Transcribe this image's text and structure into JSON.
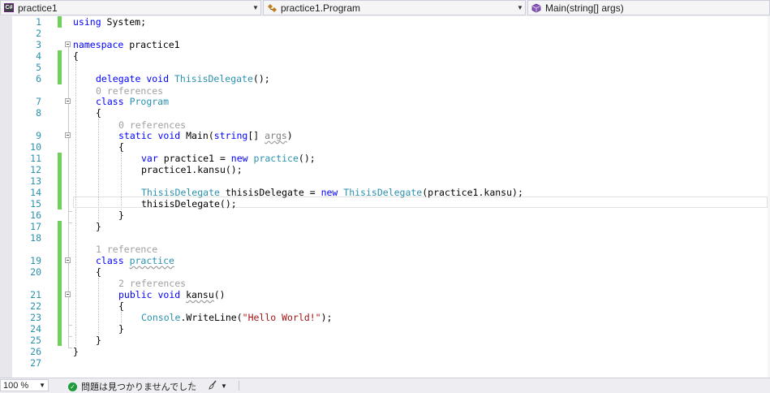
{
  "navbar": {
    "project": "practice1",
    "type": "practice1.Program",
    "member": "Main(string[] args)",
    "project_badge": "C#"
  },
  "editor": {
    "line_numbers": [
      "1",
      "2",
      "3",
      "4",
      "5",
      "6",
      "7",
      "8",
      "9",
      "10",
      "11",
      "12",
      "13",
      "14",
      "15",
      "16",
      "17",
      "18",
      "19",
      "20",
      "21",
      "22",
      "23",
      "24",
      "25",
      "26",
      "27"
    ],
    "code": {
      "l1_kw": "using",
      "l1_rest": " System;",
      "l3_kw": "namespace",
      "l3_rest": " practice1",
      "l4": "{",
      "l6_kw1": "delegate",
      "l6_kw2": "void",
      "l6_type": "ThisisDelegate",
      "l6_rest": "();",
      "l7_kw": "class",
      "l7_type": "Program",
      "l8": "{",
      "l9_kw1": "static",
      "l9_kw2": "void",
      "l9_name": "Main",
      "l9_kw3": "string",
      "l9_arg": "args",
      "l9_open": "(",
      "l9_mid": "[] ",
      "l9_close": ")",
      "l10": "{",
      "l11_kw": "var",
      "l11_mid": " practice1 = ",
      "l11_new": "new",
      "l11_type": "practice",
      "l11_rest": "();",
      "l12_obj": "practice1.",
      "l12_m": "kansu",
      "l12_rest": "();",
      "l14_type": "ThisisDelegate",
      "l14_mid": " thisisDelegate = ",
      "l14_new": "new",
      "l14_type2": "ThisisDelegate",
      "l14_arg": "(practice1.",
      "l14_m": "kansu",
      "l14_rest": ");",
      "l15": "thisisDelegate();",
      "l16": "}",
      "l17": "}",
      "l19_kw": "class",
      "l19_type": "practice",
      "l20": "{",
      "l21_kw1": "public",
      "l21_kw2": "void",
      "l21_m": "kansu",
      "l21_rest": "()",
      "l22": "{",
      "l23_type": "Console",
      "l23_dot": ".",
      "l23_m": "WriteLine",
      "l23_open": "(",
      "l23_str": "\"Hello World!\"",
      "l23_rest": ");",
      "l24": "}",
      "l25": "}",
      "l26": "}"
    },
    "codelens": {
      "program": "0 references",
      "main": "0 references",
      "practice_class": "1 reference",
      "kansu": "2 references"
    }
  },
  "statusbar": {
    "zoom": "100 %",
    "issues": "問題は見つかりませんでした"
  },
  "colors": {
    "keyword": "#0000ff",
    "type": "#2b91af",
    "string": "#a31515",
    "line_number": "#2b91af",
    "change_marker": "#6fd15b",
    "codelens": "#a0a0a0"
  },
  "icons": [
    "csharp-project-icon",
    "class-icon",
    "method-icon",
    "chevron-down-icon",
    "check-circle-icon",
    "brush-icon"
  ]
}
